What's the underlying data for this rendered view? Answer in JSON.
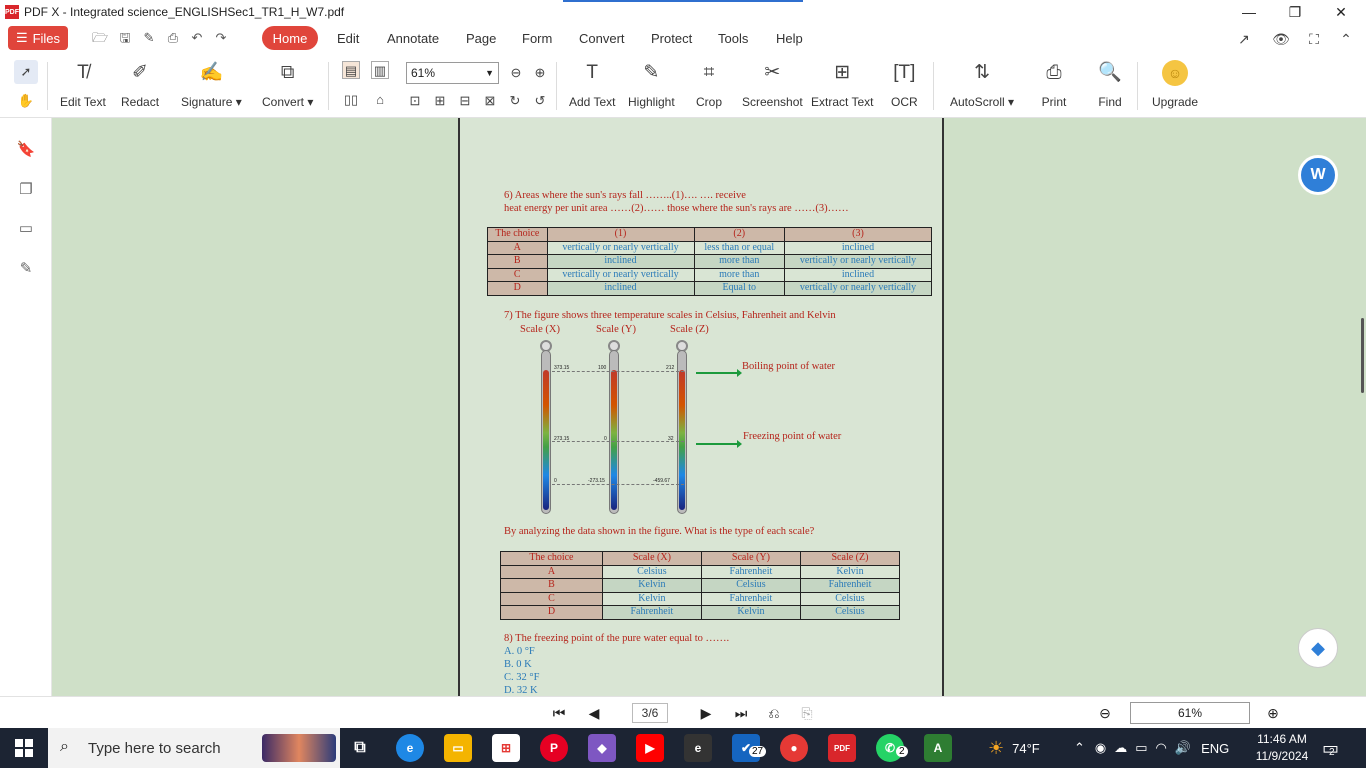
{
  "window": {
    "title": "PDF X - Integrated science_ENGLISHSec1_TR1_H_W7.pdf",
    "app_icon_text": "PDF"
  },
  "menubar": {
    "files_label": "Files",
    "items": [
      "Home",
      "Edit",
      "Annotate",
      "Page",
      "Form",
      "Convert",
      "Protect",
      "Tools",
      "Help"
    ]
  },
  "ribbon": {
    "tools": [
      "Edit Text",
      "Redact",
      "Signature ▾",
      "Convert ▾",
      "Add Text",
      "Highlight",
      "Crop",
      "Screenshot",
      "Extract Text",
      "OCR",
      "AutoScroll ▾",
      "Print",
      "Find",
      "Upgrade"
    ],
    "zoom": "61%"
  },
  "document": {
    "q6_line1": "6)  Areas  where the sun's rays fall ……..(1)…. …. receive",
    "q6_line2": "heat energy per unit area ……(2)…… those where the sun's rays are ……(3)……",
    "table1": {
      "headers": [
        "The choice",
        "(1)",
        "(2)",
        "(3)"
      ],
      "rows": [
        [
          "A",
          "vertically or nearly vertically",
          "less than or equal",
          "inclined"
        ],
        [
          "B",
          "inclined",
          "more than",
          "vertically or nearly vertically"
        ],
        [
          "C",
          "vertically or nearly vertically",
          "more than",
          "inclined"
        ],
        [
          "D",
          "inclined",
          "Equal to",
          "vertically or nearly vertically"
        ]
      ]
    },
    "q7_line": "7) The figure shows three temperature scales in Celsius, Fahrenheit and Kelvin",
    "scales": [
      "Scale (X)",
      "Scale (Y)",
      "Scale (Z)"
    ],
    "therm_x": [
      "373.15",
      "273.15",
      "0"
    ],
    "therm_y": [
      "100",
      "0",
      "-273.15"
    ],
    "therm_z": [
      "212",
      "32",
      "-459.67"
    ],
    "boiling_label": "Boiling point of water",
    "freezing_label": "Freezing point of water",
    "q7_prompt": "By analyzing the data shown in the figure. What is the type of each scale?",
    "table2": {
      "headers": [
        "The choice",
        "Scale (X)",
        "Scale (Y)",
        "Scale (Z)"
      ],
      "rows": [
        [
          "A",
          "Celsius",
          "Fahrenheit",
          "Kelvin"
        ],
        [
          "B",
          "Kelvin",
          "Celsius",
          "Fahrenheit"
        ],
        [
          "C",
          "Kelvin",
          "Fahrenheit",
          "Celsius"
        ],
        [
          "D",
          "Fahrenheit",
          "Kelvin",
          "Celsius"
        ]
      ]
    },
    "q8_line": "8) The freezing point of the pure water equal to …….",
    "q8_options": [
      "A. 0 °F",
      "B. 0 K",
      "C. 32 °F",
      "D. 32 K"
    ]
  },
  "bottomnav": {
    "page": "3/6",
    "zoom": "61%"
  },
  "taskbar": {
    "search_placeholder": "Type here to search",
    "weather": "74°F",
    "lang": "ENG",
    "time": "11:46 AM",
    "date": "11/9/2024",
    "notif_count": "2",
    "todo_badge": "27",
    "whatsapp_badge": "2"
  }
}
